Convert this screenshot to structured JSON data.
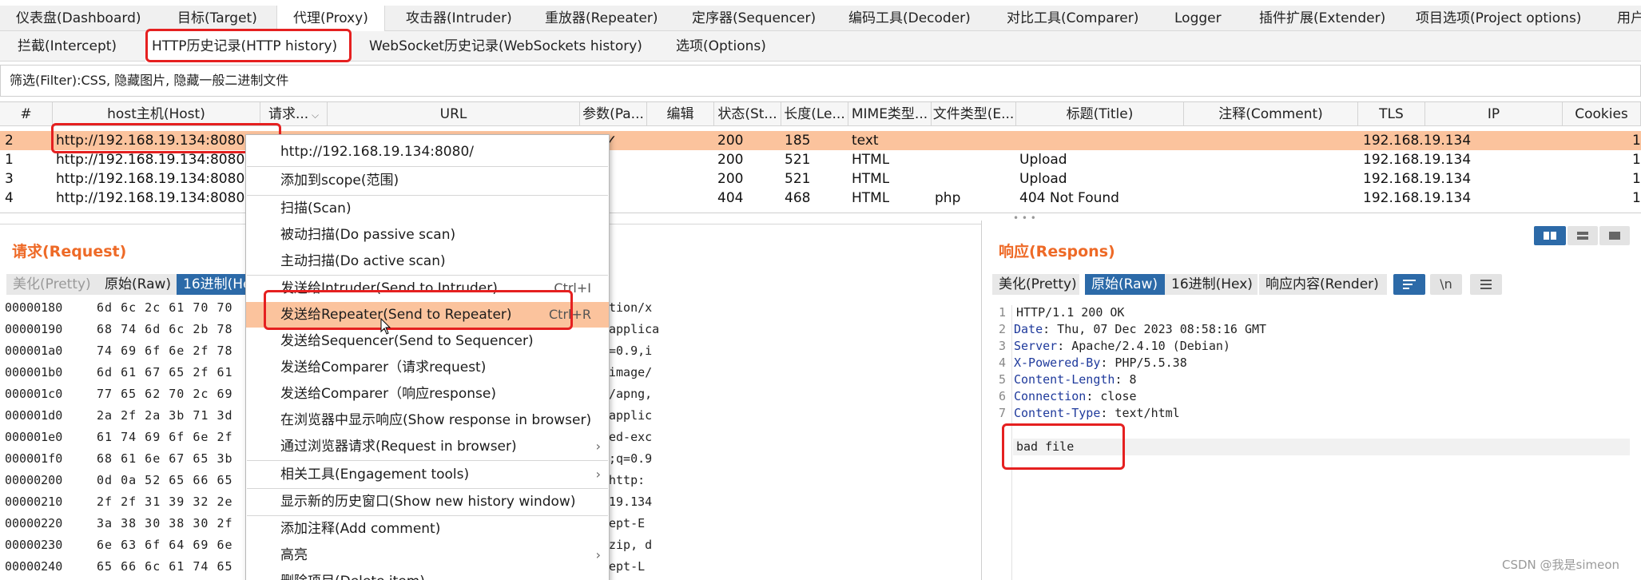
{
  "main_tabs": [
    {
      "label": "仪表盘(Dashboard)"
    },
    {
      "label": "目标(Target)"
    },
    {
      "label": "代理(Proxy)"
    },
    {
      "label": "攻击器(Intruder)"
    },
    {
      "label": "重放器(Repeater)"
    },
    {
      "label": "定序器(Sequencer)"
    },
    {
      "label": "编码工具(Decoder)"
    },
    {
      "label": "对比工具(Comparer)"
    },
    {
      "label": "Logger"
    },
    {
      "label": "插件扩展(Extender)"
    },
    {
      "label": "项目选项(Project options)"
    },
    {
      "label": "用户"
    }
  ],
  "sub_tabs": [
    {
      "label": "拦截(Intercept)"
    },
    {
      "label": "HTTP历史记录(HTTP history)"
    },
    {
      "label": "WebSocket历史记录(WebSockets history)"
    },
    {
      "label": "选项(Options)"
    }
  ],
  "filter": {
    "text": "筛选(Filter):CSS, 隐藏图片, 隐藏一般二进制文件"
  },
  "table": {
    "columns": [
      "#",
      "host主机(Host)",
      "请求...",
      "URL",
      "参数(Pa...",
      "编辑",
      "状态(St...",
      "长度(Le...",
      "MIME类型...",
      "文件类型(E...",
      "标题(Title)",
      "注释(Comment)",
      "TLS",
      "IP",
      "Cookies"
    ],
    "rows": [
      {
        "num": "2",
        "host": "http://192.168.19.134:8080",
        "params": "✓",
        "status": "200",
        "length": "185",
        "mime": "text",
        "ext": "",
        "title": "",
        "ip": "192.168.19.134",
        "last": "1"
      },
      {
        "num": "1",
        "host": "http://192.168.19.134:8080",
        "params": "",
        "status": "200",
        "length": "521",
        "mime": "HTML",
        "ext": "",
        "title": "Upload",
        "ip": "192.168.19.134",
        "last": "1"
      },
      {
        "num": "3",
        "host": "http://192.168.19.134:8080",
        "params": "",
        "status": "200",
        "length": "521",
        "mime": "HTML",
        "ext": "",
        "title": "Upload",
        "ip": "192.168.19.134",
        "last": "1"
      },
      {
        "num": "4",
        "host": "http://192.168.19.134:8080",
        "params": "",
        "status": "404",
        "length": "468",
        "mime": "HTML",
        "ext": "php",
        "title": "404 Not Found",
        "ip": "192.168.19.134",
        "last": "1"
      }
    ]
  },
  "request": {
    "title": "请求(Request)",
    "tabs": [
      "美化(Pretty)",
      "原始(Raw)",
      "16进制(He"
    ],
    "hex_rows": [
      {
        "addr": "00000180",
        "bytes": "6d 6c 2c 61 70 70",
        "ascii": "tion/x"
      },
      {
        "addr": "00000190",
        "bytes": "68 74 6d 6c 2b 78",
        "ascii": "applica"
      },
      {
        "addr": "000001a0",
        "bytes": "74 69 6f 6e 2f 78",
        "ascii": "=0.9,i"
      },
      {
        "addr": "000001b0",
        "bytes": "6d 61 67 65 2f 61",
        "ascii": "image/"
      },
      {
        "addr": "000001c0",
        "bytes": "77 65 62 70 2c 69",
        "ascii": "/apng,"
      },
      {
        "addr": "000001d0",
        "bytes": "2a 2f 2a 3b 71 3d",
        "ascii": "applic"
      },
      {
        "addr": "000001e0",
        "bytes": "61 74 69 6f 6e 2f",
        "ascii": "ed-exc"
      },
      {
        "addr": "000001f0",
        "bytes": "68 61 6e 67 65 3b",
        "ascii": ";q=0.9"
      },
      {
        "addr": "00000200",
        "bytes": "0d 0a 52 65 66 65",
        "ascii": "http:"
      },
      {
        "addr": "00000210",
        "bytes": "2f 2f 31 39 32 2e",
        "ascii": "19.134"
      },
      {
        "addr": "00000220",
        "bytes": "3a 38 30 38 30 2f",
        "ascii": "ept-E"
      },
      {
        "addr": "00000230",
        "bytes": "6e 63 6f 64 69 6e",
        "ascii": "zip, d"
      },
      {
        "addr": "00000240",
        "bytes": "65 66 6c 61 74 65",
        "ascii": "ept-L"
      }
    ]
  },
  "response": {
    "title": "响应(Respons)",
    "tabs": [
      "美化(Pretty)",
      "原始(Raw)",
      "16进制(Hex)",
      "响应内容(Render)"
    ],
    "newline_label": "\\n",
    "lines": [
      {
        "n": "1",
        "name": "",
        "value": "HTTP/1.1 200 OK"
      },
      {
        "n": "2",
        "name": "Date",
        "value": ": Thu, 07 Dec 2023 08:58:16 GMT"
      },
      {
        "n": "3",
        "name": "Server",
        "value": ": Apache/2.4.10 (Debian)"
      },
      {
        "n": "4",
        "name": "X-Powered-By",
        "value": ": PHP/5.5.38"
      },
      {
        "n": "5",
        "name": "Content-Length",
        "value": ": 8"
      },
      {
        "n": "6",
        "name": "Connection",
        "value": ": close"
      },
      {
        "n": "7",
        "name": "Content-Type",
        "value": ": text/html"
      }
    ],
    "body": "bad file"
  },
  "context_menu": {
    "items": [
      {
        "label": "http://192.168.19.134:8080/",
        "shortcut": "",
        "submenu": false
      },
      {
        "label": "添加到scope(范围)",
        "shortcut": "",
        "submenu": false
      },
      {
        "label": "扫描(Scan)",
        "shortcut": "",
        "submenu": false
      },
      {
        "label": "被动扫描(Do passive scan)",
        "shortcut": "",
        "submenu": false
      },
      {
        "label": "主动扫描(Do active scan)",
        "shortcut": "",
        "submenu": false
      },
      {
        "label": "发送给Intruder(Send to Intruder)",
        "shortcut": "Ctrl+I",
        "submenu": false
      },
      {
        "label": "发送给Repeater(Send to Repeater)",
        "shortcut": "Ctrl+R",
        "submenu": false
      },
      {
        "label": "发送给Sequencer(Send to Sequencer)",
        "shortcut": "",
        "submenu": false
      },
      {
        "label": "发送给Comparer（请求request)",
        "shortcut": "",
        "submenu": false
      },
      {
        "label": "发送给Comparer（响应response)",
        "shortcut": "",
        "submenu": false
      },
      {
        "label": "在浏览器中显示响应(Show response in browser)",
        "shortcut": "",
        "submenu": false
      },
      {
        "label": "通过浏览器请求(Request in browser)",
        "shortcut": "",
        "submenu": true
      },
      {
        "label": "相关工具(Engagement tools)",
        "shortcut": "",
        "submenu": true
      },
      {
        "label": "显示新的历史窗口(Show new history window)",
        "shortcut": "",
        "submenu": false
      },
      {
        "label": "添加注释(Add comment)",
        "shortcut": "",
        "submenu": false
      },
      {
        "label": "高亮",
        "shortcut": "",
        "submenu": true
      },
      {
        "label": "删除项目(Delete item)",
        "shortcut": "",
        "submenu": false
      }
    ]
  },
  "watermark": "CSDN @我是simeon",
  "colors": {
    "accent": "#ee6a27",
    "highlight": "#fbc39d",
    "active_tab": "#2c6aa8",
    "annotation": "#e52020"
  }
}
